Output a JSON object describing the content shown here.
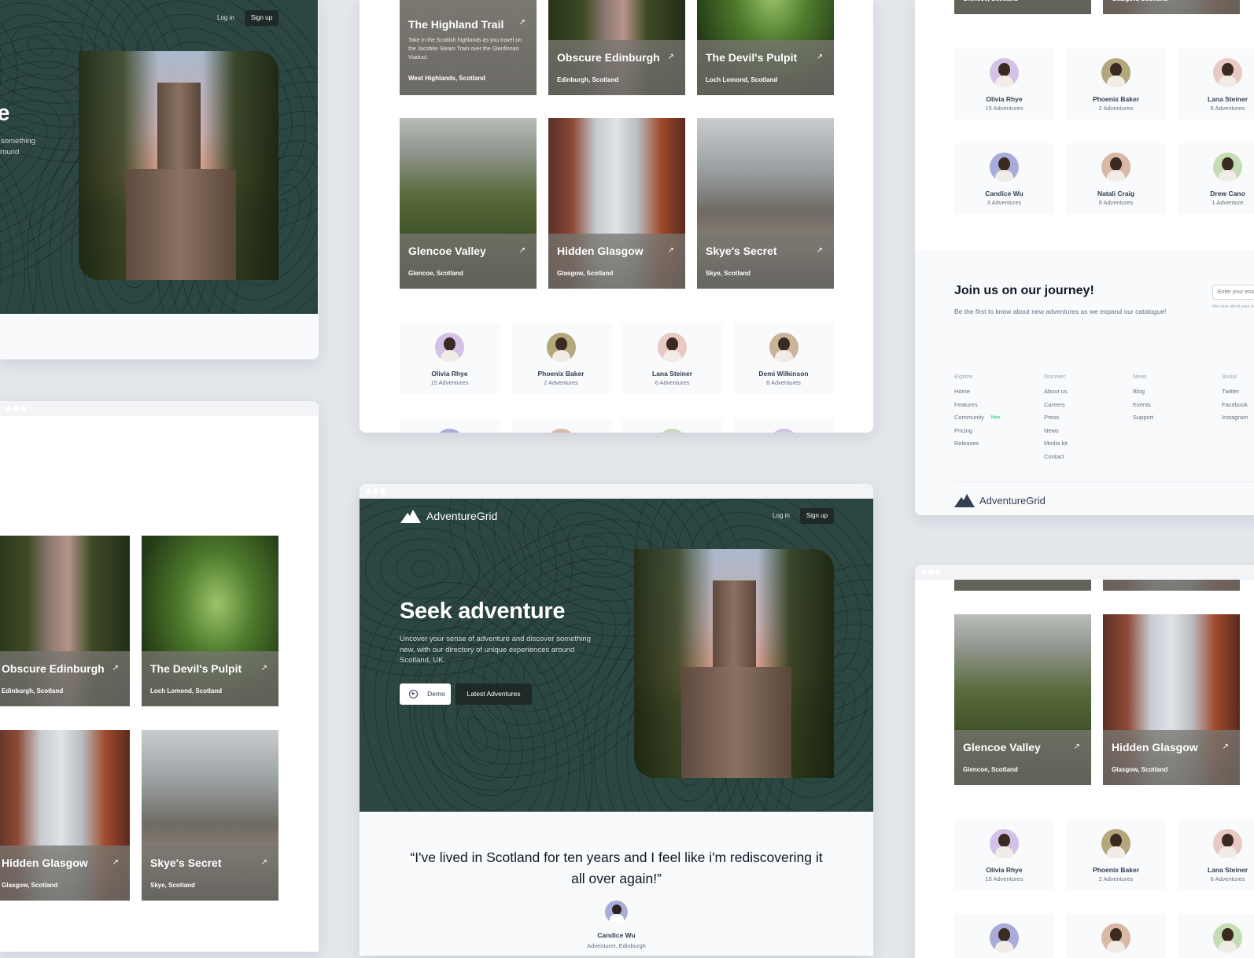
{
  "brand": {
    "name": "AdventureGrid",
    "accent": "#2c4641"
  },
  "nav": {
    "login": "Log in",
    "signup": "Sign up"
  },
  "hero": {
    "title": "Seek adventure",
    "description": "Uncover your sense of adventure and discover something new, with our directory of unique experiences around Scotland, UK.",
    "demo_button": "Demo",
    "latest_button": "Latest Adventures"
  },
  "testimonial": {
    "quote_line1": "“I've lived in Scotland for ten years and I feel like i'm rediscovering it",
    "quote_line2": "all over again!”",
    "name": "Candice Wu",
    "role": "Adventurer, Edinburgh"
  },
  "adventures": [
    {
      "title": "The Highland Trail",
      "location": "West Highlands, Scotland",
      "description": "Take in the Scottish highlands as you travel on the Jacobite Steam Train over the Glenfinnan Viaduct.",
      "icon": "arrow-up-right-icon"
    },
    {
      "title": "Obscure Edinburgh",
      "location": "Edinburgh, Scotland",
      "icon": "arrow-up-right-icon"
    },
    {
      "title": "The Devil's Pulpit",
      "location": "Loch Lomond, Scotland",
      "icon": "arrow-up-right-icon"
    },
    {
      "title": "Glencoe Valley",
      "location": "Glencoe, Scotland",
      "icon": "arrow-up-right-icon"
    },
    {
      "title": "Hidden Glasgow",
      "location": "Glasgow, Scotland",
      "icon": "arrow-up-right-icon"
    },
    {
      "title": "Skye's Secret",
      "location": "Skye, Scotland",
      "icon": "arrow-up-right-icon"
    }
  ],
  "people": [
    {
      "name": "Olivia Rhye",
      "count": "15 Adventures",
      "color": "#d4c2e6"
    },
    {
      "name": "Phoenix Baker",
      "count": "2 Adventures",
      "color": "#b3a77c"
    },
    {
      "name": "Lana Steiner",
      "count": "6 Adventures",
      "color": "#e8c9c4"
    },
    {
      "name": "Demi Wilkinson",
      "count": "8 Adventures",
      "color": "#c9b49a"
    },
    {
      "name": "Candice Wu",
      "count": "3 Adventures",
      "color": "#a9acd8"
    },
    {
      "name": "Natali Craig",
      "count": "9 Adventures",
      "color": "#d9b8a4"
    },
    {
      "name": "Drew Cano",
      "count": "1 Adventure",
      "color": "#c6dcb4"
    }
  ],
  "newsletter": {
    "title": "Join us on our journey!",
    "subtitle": "Be the first to know about new adventures as we expand our catalogue!",
    "email_placeholder": "Enter your email",
    "privacy_note": "We care about your data in our privacy policy."
  },
  "footer": {
    "columns": [
      {
        "heading": "Explore",
        "items": [
          "Home",
          "Features",
          "Community",
          "Pricing",
          "Releases"
        ]
      },
      {
        "heading": "Discover",
        "items": [
          "About us",
          "Careers",
          "Press",
          "News",
          "Media kit",
          "Contact"
        ]
      },
      {
        "heading": "News",
        "items": [
          "Blog",
          "Events",
          "Support"
        ]
      },
      {
        "heading": "Social",
        "items": [
          "Twitter",
          "Facebook",
          "Instagram"
        ]
      }
    ],
    "new_badge": "New"
  }
}
